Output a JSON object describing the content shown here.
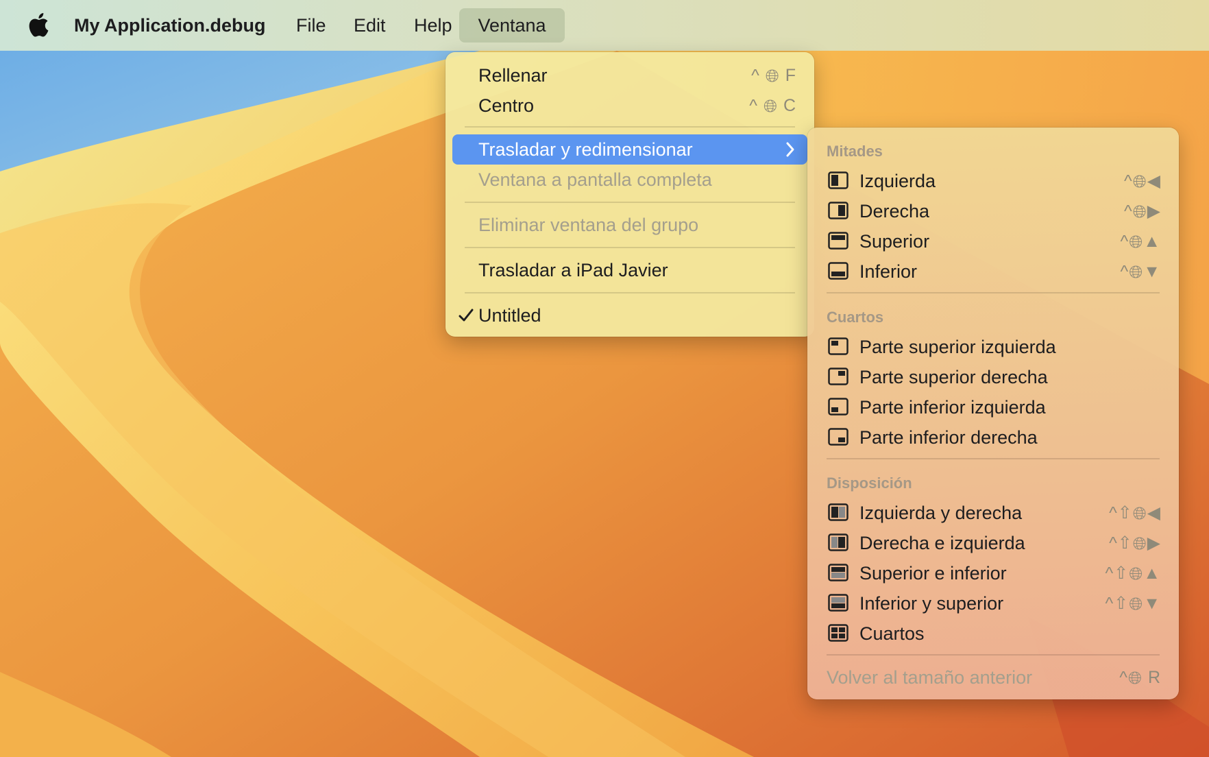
{
  "menubar": {
    "app_name": "My Application.debug",
    "items": [
      "File",
      "Edit",
      "Help",
      "Ventana"
    ]
  },
  "ventana_menu": {
    "rellenar": "Rellenar",
    "rellenar_sc": "F",
    "centro": "Centro",
    "centro_sc": "C",
    "trasladar_redim": "Trasladar y redimensionar",
    "pantalla_completa": "Ventana a pantalla completa",
    "eliminar_grupo": "Eliminar ventana del grupo",
    "trasladar_ipad": "Trasladar a iPad Javier",
    "untitled": "Untitled"
  },
  "submenu": {
    "sections": {
      "mitades": "Mitades",
      "cuartos": "Cuartos",
      "disposicion": "Disposición"
    },
    "mitades": [
      {
        "label": "Izquierda",
        "arrow": "◀"
      },
      {
        "label": "Derecha",
        "arrow": "▶"
      },
      {
        "label": "Superior",
        "arrow": "▲"
      },
      {
        "label": "Inferior",
        "arrow": "▼"
      }
    ],
    "cuartos": [
      {
        "label": "Parte superior izquierda"
      },
      {
        "label": "Parte superior derecha"
      },
      {
        "label": "Parte inferior izquierda"
      },
      {
        "label": "Parte inferior derecha"
      }
    ],
    "disposicion": [
      {
        "label": "Izquierda y derecha",
        "arrow": "◀"
      },
      {
        "label": "Derecha e izquierda",
        "arrow": "▶"
      },
      {
        "label": "Superior e inferior",
        "arrow": "▲"
      },
      {
        "label": "Inferior y superior",
        "arrow": "▼"
      },
      {
        "label": "Cuartos"
      }
    ],
    "volver": "Volver al tamaño anterior",
    "volver_sc": "R"
  },
  "colors": {
    "highlight": "#5b95f0",
    "desktop_orange": "#e9913c",
    "desktop_yellow": "#fbd46a",
    "desktop_blue": "#74b3e6"
  }
}
